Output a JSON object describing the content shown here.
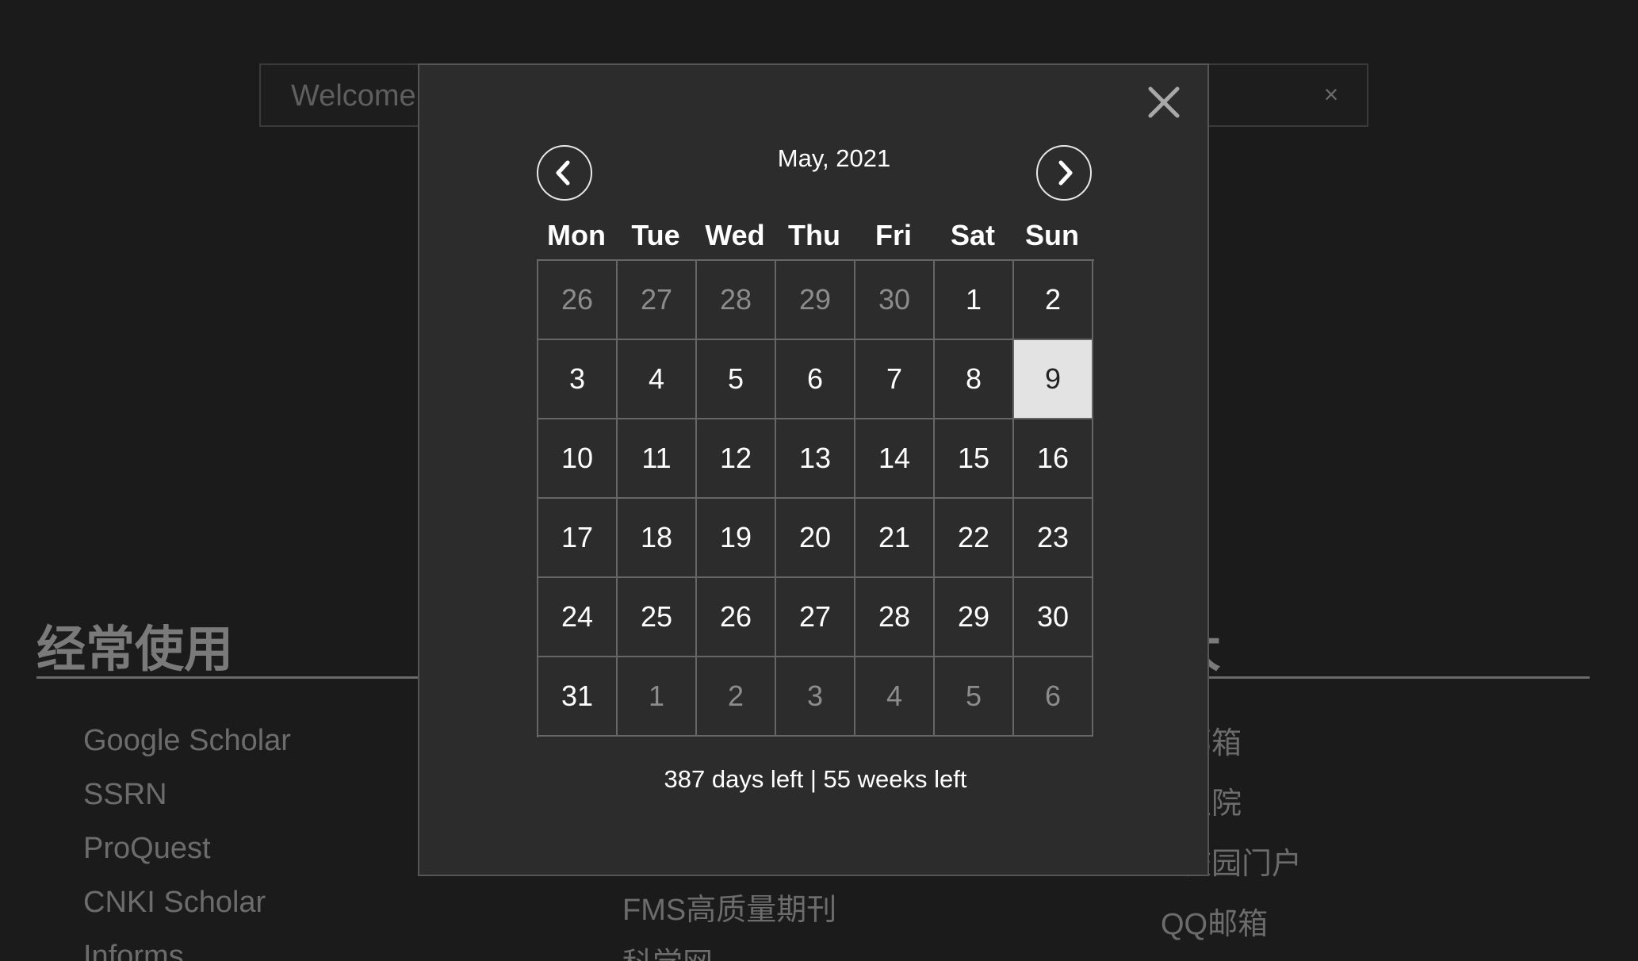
{
  "search": {
    "value": "Welcome",
    "clear_icon": "×"
  },
  "sections": {
    "left": {
      "title": "经常使用",
      "links": [
        "Google Scholar",
        "SSRN",
        "ProQuest",
        "CNKI Scholar",
        "Informs"
      ]
    },
    "middle": {
      "links": [
        "FMS高质量期刊",
        "科学网"
      ]
    },
    "right": {
      "title": "人大",
      "links": [
        "人大邮箱",
        "研究生院",
        "人大校园门户",
        "QQ邮箱"
      ]
    }
  },
  "calendar": {
    "month_title": "May, 2021",
    "weekdays": [
      "Mon",
      "Tue",
      "Wed",
      "Thu",
      "Fri",
      "Sat",
      "Sun"
    ],
    "days": [
      {
        "label": "26",
        "muted": true
      },
      {
        "label": "27",
        "muted": true
      },
      {
        "label": "28",
        "muted": true
      },
      {
        "label": "29",
        "muted": true
      },
      {
        "label": "30",
        "muted": true
      },
      {
        "label": "1"
      },
      {
        "label": "2"
      },
      {
        "label": "3"
      },
      {
        "label": "4"
      },
      {
        "label": "5"
      },
      {
        "label": "6"
      },
      {
        "label": "7"
      },
      {
        "label": "8"
      },
      {
        "label": "9",
        "today": true
      },
      {
        "label": "10"
      },
      {
        "label": "11"
      },
      {
        "label": "12"
      },
      {
        "label": "13"
      },
      {
        "label": "14"
      },
      {
        "label": "15"
      },
      {
        "label": "16"
      },
      {
        "label": "17"
      },
      {
        "label": "18"
      },
      {
        "label": "19"
      },
      {
        "label": "20"
      },
      {
        "label": "21"
      },
      {
        "label": "22"
      },
      {
        "label": "23"
      },
      {
        "label": "24"
      },
      {
        "label": "25"
      },
      {
        "label": "26"
      },
      {
        "label": "27"
      },
      {
        "label": "28"
      },
      {
        "label": "29"
      },
      {
        "label": "30"
      },
      {
        "label": "31"
      },
      {
        "label": "1",
        "muted": true
      },
      {
        "label": "2",
        "muted": true
      },
      {
        "label": "3",
        "muted": true
      },
      {
        "label": "4",
        "muted": true
      },
      {
        "label": "5",
        "muted": true
      },
      {
        "label": "6",
        "muted": true
      }
    ],
    "countdown": "387 days left | 55 weeks left",
    "prev_icon": "chevron-left-icon",
    "next_icon": "chevron-right-icon",
    "close_icon": "close-icon"
  },
  "colors": {
    "background": "#1b1b1b",
    "modal": "#2c2c2c",
    "today_highlight": "#e3e3e3"
  }
}
